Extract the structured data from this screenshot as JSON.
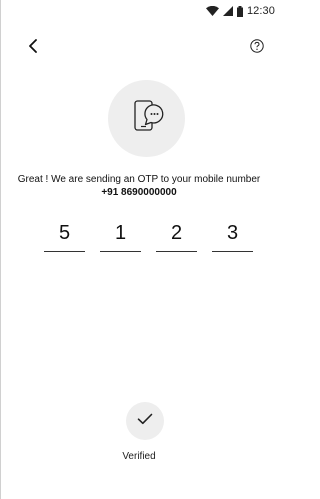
{
  "status_bar": {
    "time": "12:30",
    "icons": [
      "wifi-icon",
      "signal-icon",
      "battery-icon"
    ]
  },
  "top_bar": {
    "back_icon": "chevron-left-icon",
    "help_icon": "help-circle-icon"
  },
  "hero": {
    "icon": "phone-chat-bubble-icon"
  },
  "message": {
    "text": "Great ! We are sending an OTP to your mobile number",
    "phone": "+91 8690000000"
  },
  "otp": {
    "digits": [
      "5",
      "1",
      "2",
      "3"
    ]
  },
  "verification": {
    "icon": "check-icon",
    "label": "Verified"
  },
  "colors": {
    "background": "#ffffff",
    "circle_fill": "#eeeeee",
    "text": "#111111",
    "underline": "#333333"
  }
}
